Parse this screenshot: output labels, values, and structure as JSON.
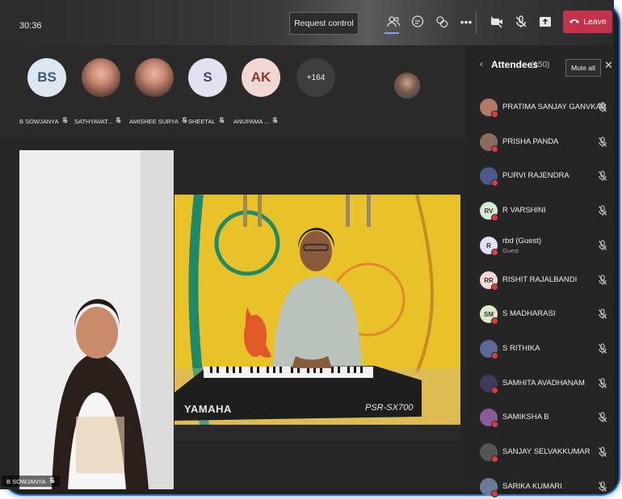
{
  "meeting": {
    "timer": "30:36",
    "request_control_label": "Request control",
    "leave_label": "Leave",
    "icons": [
      "people-icon",
      "chat-icon",
      "raise-hand-icon",
      "more-icon",
      "camera-off-icon",
      "mic-off-icon",
      "share-icon",
      "phone-icon"
    ]
  },
  "strip": {
    "participants": [
      {
        "initials": "BS",
        "name": "B SOWJANYA",
        "bg": "#dde7ef",
        "fg": "#3a5a78",
        "photo": false
      },
      {
        "initials": "",
        "name": "SATHYAVAT...",
        "bg": "",
        "fg": "",
        "photo": true
      },
      {
        "initials": "",
        "name": "AMISHEE SURYA",
        "bg": "",
        "fg": "",
        "photo": true
      },
      {
        "initials": "S",
        "name": "SHEETAL",
        "bg": "#e4e0f1",
        "fg": "#4a3f7a",
        "photo": false
      },
      {
        "initials": "AK",
        "name": "ANUPAMA ...",
        "bg": "#f2d8d4",
        "fg": "#8a3a2e",
        "photo": false
      }
    ],
    "overflow": "+164"
  },
  "video": {
    "tile1_name": "B SOWJANYA",
    "keyboard_brand": "YAMAHA",
    "keyboard_model": "PSR-SX700"
  },
  "panel": {
    "title": "Attendees",
    "count": "(150)",
    "mute_all_label": "Mute all",
    "attendees": [
      {
        "name": "PRATIMA SANJAY GANVKAR",
        "initials": "",
        "sub": "",
        "bg": "#b07a66"
      },
      {
        "name": "PRISHA PANDA",
        "initials": "",
        "sub": "",
        "bg": "#8a6d5c"
      },
      {
        "name": "PURVI RAJENDRA",
        "initials": "",
        "sub": "",
        "bg": "#4b5a8a"
      },
      {
        "name": "R VARSHINI",
        "initials": "RV",
        "sub": "",
        "bg": "#d7ecd7"
      },
      {
        "name": "rbd (Guest)",
        "initials": "R",
        "sub": "Guest",
        "bg": "#e1dff1"
      },
      {
        "name": "RISHIT RAJALBANDI",
        "initials": "RR",
        "sub": "",
        "bg": "#f4d8d6"
      },
      {
        "name": "S MADHARASI",
        "initials": "SM",
        "sub": "",
        "bg": "#dde9c8"
      },
      {
        "name": "S RITHIKA",
        "initials": "",
        "sub": "",
        "bg": "#5a6a98"
      },
      {
        "name": "SAMHITA AVADHANAM",
        "initials": "",
        "sub": "",
        "bg": "#3c3c5a"
      },
      {
        "name": "SAMIKSHA B",
        "initials": "",
        "sub": "",
        "bg": "#8a5a9a"
      },
      {
        "name": "SANJAY SELVAKKUMAR",
        "initials": "",
        "sub": "",
        "bg": "#555555"
      },
      {
        "name": "SARIKA KUMARI",
        "initials": "",
        "sub": "",
        "bg": "#6a7a98"
      }
    ]
  }
}
